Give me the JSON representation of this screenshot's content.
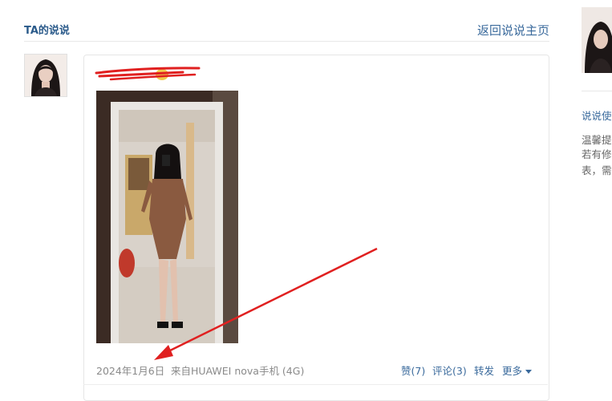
{
  "header": {
    "title": "TA的说说",
    "back_link": "返回说说主页"
  },
  "post": {
    "date": "2024年1月6日",
    "source": "来自HUAWEI nova手机 (4G)",
    "actions": {
      "like": "赞(7)",
      "comment": "评论(3)",
      "forward": "转发",
      "more": "更多"
    }
  },
  "sidebar": {
    "link": "说说使",
    "text_lines": [
      "温馨提",
      "若有修",
      "表，需"
    ]
  },
  "colors": {
    "link": "#3a6a9c",
    "annotation": "#e02020"
  }
}
